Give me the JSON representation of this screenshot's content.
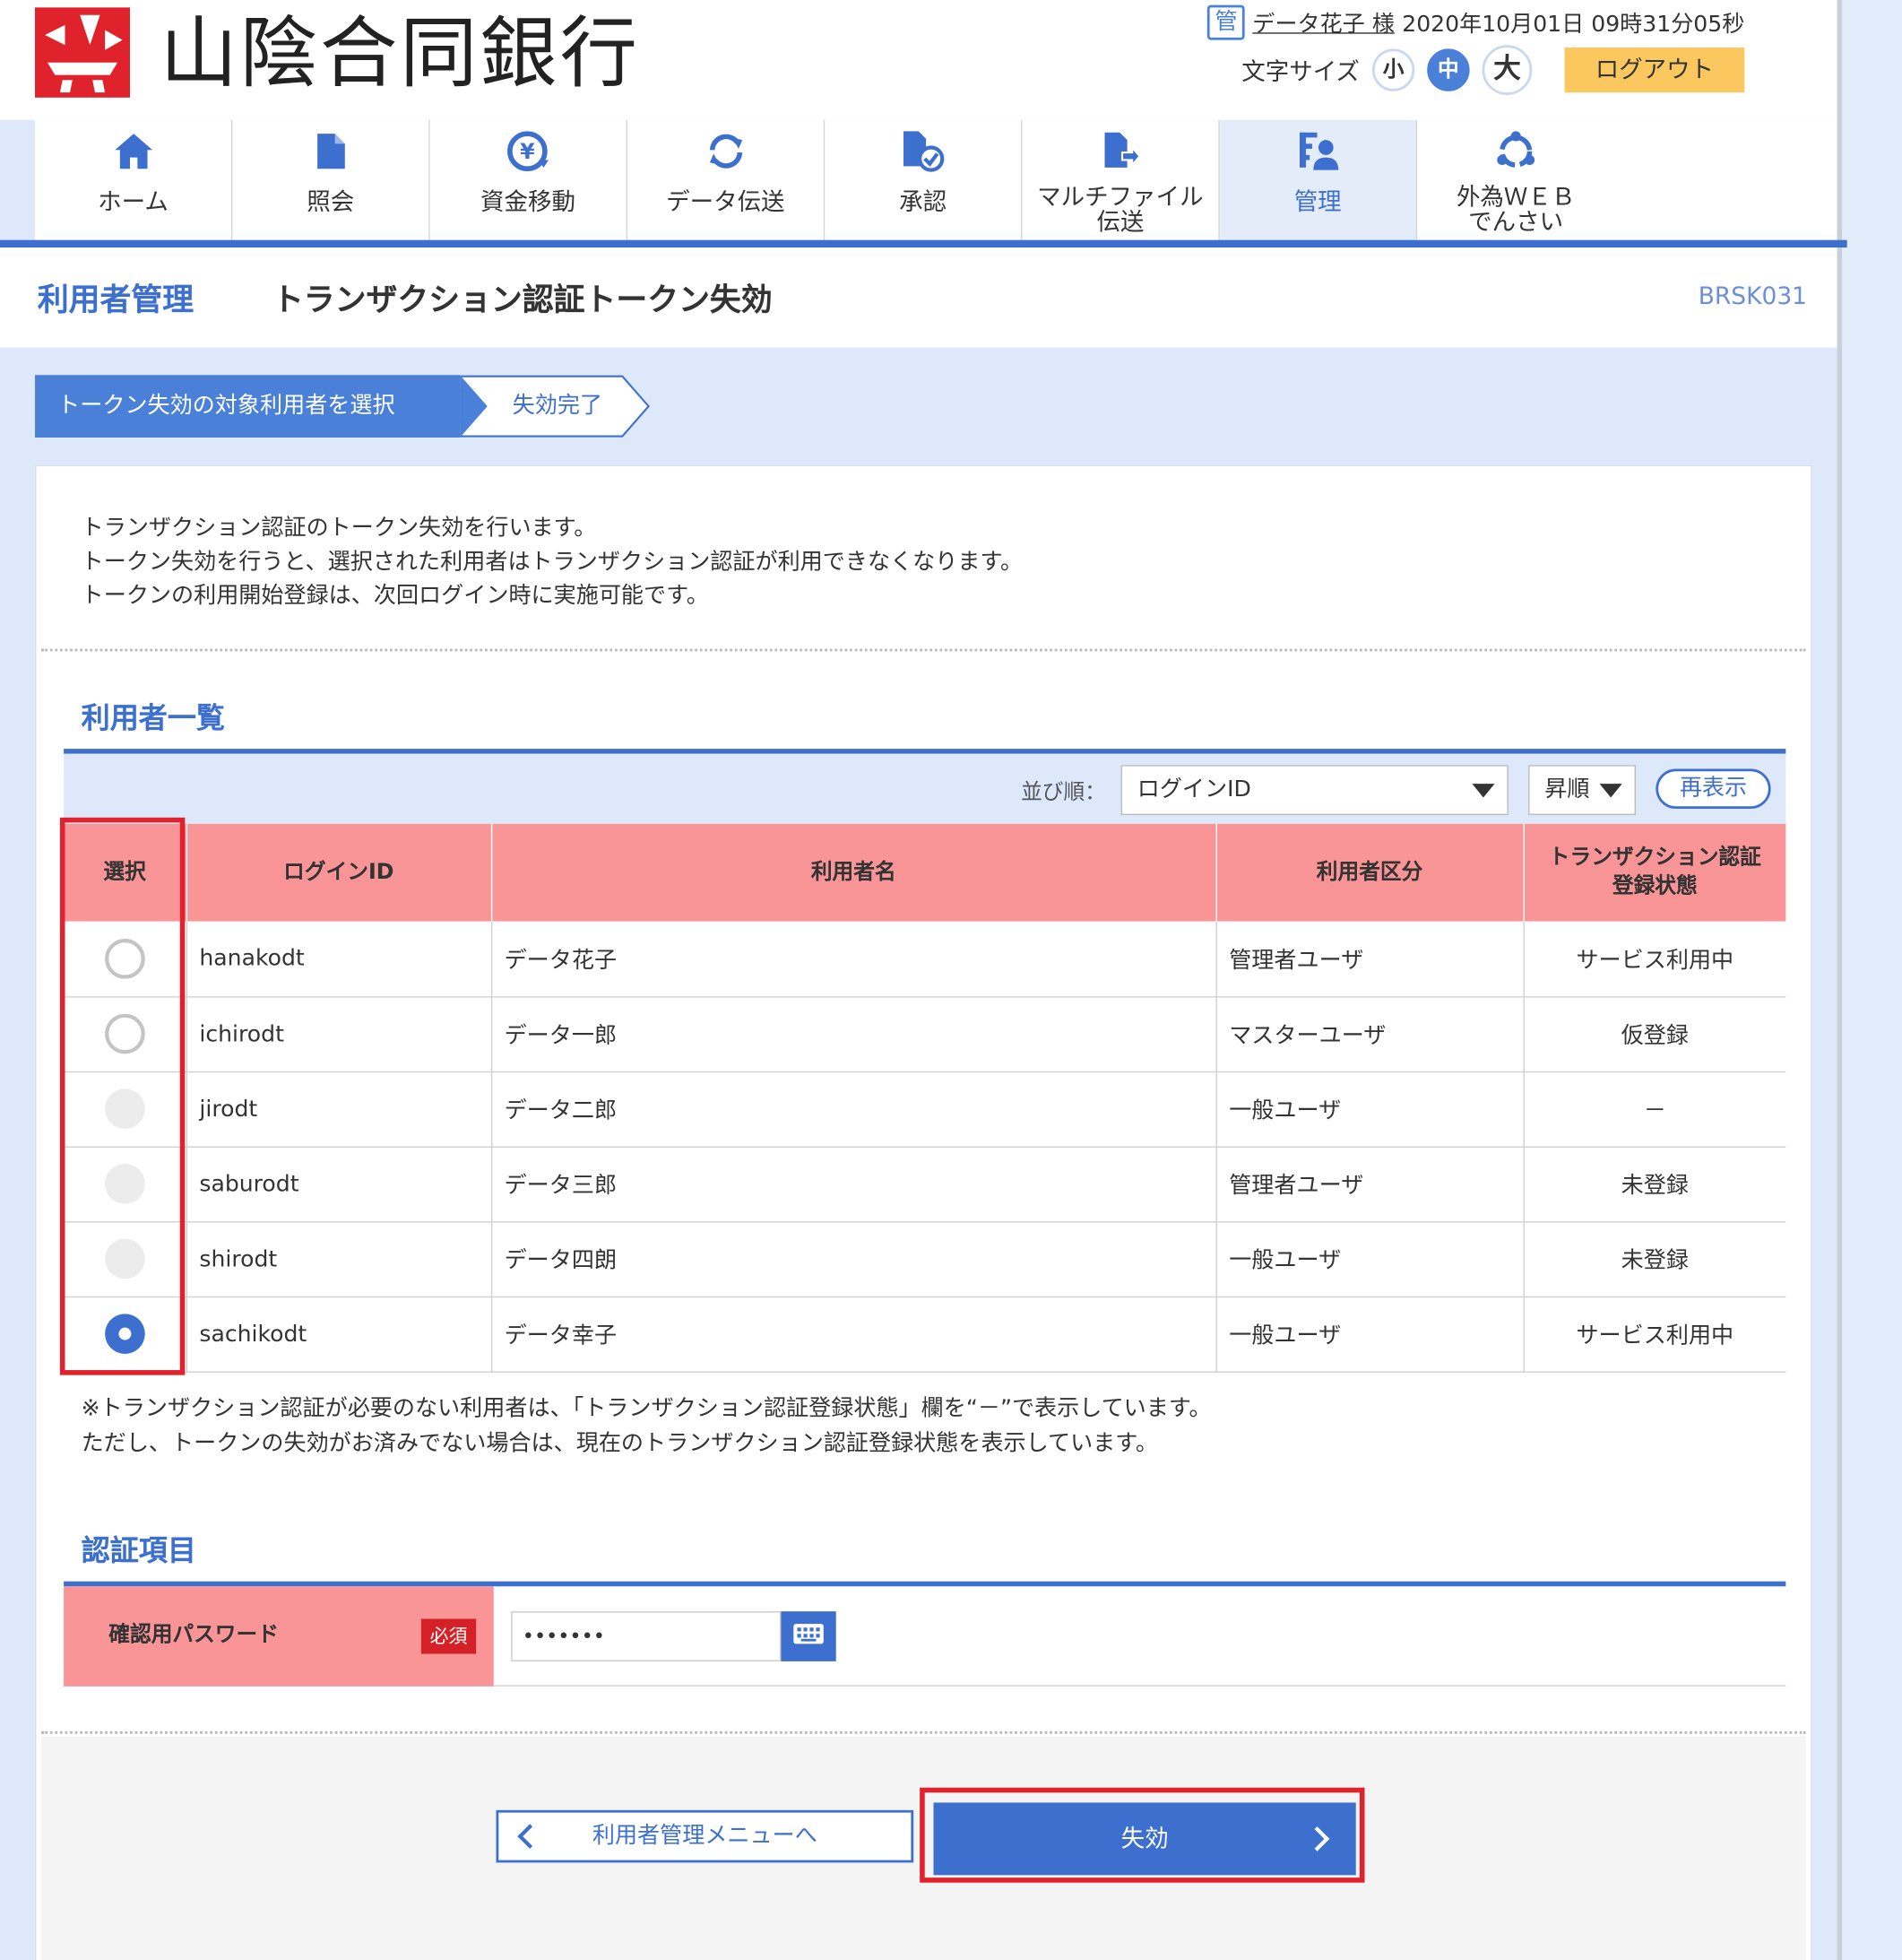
{
  "header": {
    "bank_name": "山陰合同銀行",
    "manager_icon": "管",
    "user_name": "データ花子 様",
    "datetime": "2020年10月01日 09時31分05秒",
    "font_size_label": "文字サイズ",
    "font_small": "小",
    "font_medium": "中",
    "font_large": "大",
    "logout": "ログアウト"
  },
  "nav": {
    "items": [
      {
        "label": "ホーム",
        "icon": "home-icon"
      },
      {
        "label": "照会",
        "icon": "document-icon"
      },
      {
        "label": "資金移動",
        "icon": "yen-transfer-icon"
      },
      {
        "label": "データ伝送",
        "icon": "refresh-icon"
      },
      {
        "label": "承認",
        "icon": "approve-icon"
      },
      {
        "label": "マルチファイル\n伝送",
        "icon": "multi-file-icon"
      },
      {
        "label": "管理",
        "icon": "admin-icon"
      },
      {
        "label": "外為ＷＥＢ\nでんさい",
        "icon": "forex-icon"
      }
    ],
    "active": "管理"
  },
  "title": {
    "category": "利用者管理",
    "main": "トランザクション認証トークン失効",
    "code": "BRSK031"
  },
  "steps": {
    "step1": "トークン失効の対象利用者を選択",
    "step2": "失効完了"
  },
  "intro": {
    "line1": "トランザクション認証のトークン失効を行います。",
    "line2": "トークン失効を行うと、選択された利用者はトランザクション認証が利用できなくなります。",
    "line3": "トークンの利用開始登録は、次回ログイン時に実施可能です。"
  },
  "user_list": {
    "title": "利用者一覧",
    "sort_label": "並び順：",
    "sort_key": "ログインID",
    "sort_order": "昇順",
    "refresh": "再表示",
    "columns": {
      "select": "選択",
      "login_id": "ログインID",
      "name": "利用者名",
      "type": "利用者区分",
      "status_line1": "トランザクション認証",
      "status_line2": "登録状態"
    },
    "rows": [
      {
        "id": "hanakodt",
        "name": "データ花子",
        "type": "管理者ユーザ",
        "status": "サービス利用中"
      },
      {
        "id": "ichirodt",
        "name": "データ一郎",
        "type": "マスターユーザ",
        "status": "仮登録"
      },
      {
        "id": "jirodt",
        "name": "データ二郎",
        "type": "一般ユーザ",
        "status": "－"
      },
      {
        "id": "saburodt",
        "name": "データ三郎",
        "type": "管理者ユーザ",
        "status": "未登録"
      },
      {
        "id": "shirodt",
        "name": "データ四朗",
        "type": "一般ユーザ",
        "status": "未登録"
      },
      {
        "id": "sachikodt",
        "name": "データ幸子",
        "type": "一般ユーザ",
        "status": "サービス利用中"
      }
    ],
    "note1": "※トランザクション認証が必要のない利用者は、「トランザクション認証登録状態」欄を“－”で表示しています。",
    "note2": "ただし、トークンの失効がお済みでない場合は、現在のトランザクション認証登録状態を表示しています。"
  },
  "auth": {
    "title": "認証項目",
    "password_label": "確認用パスワード",
    "required": "必須",
    "password_value": "•••••••"
  },
  "buttons": {
    "back": "利用者管理メニューへ",
    "submit": "失効"
  },
  "colors": {
    "brand_blue": "#3d6fcf",
    "header_pink": "#f99497",
    "logo_red": "#e0222c",
    "logout_yellow": "#fbc860"
  }
}
